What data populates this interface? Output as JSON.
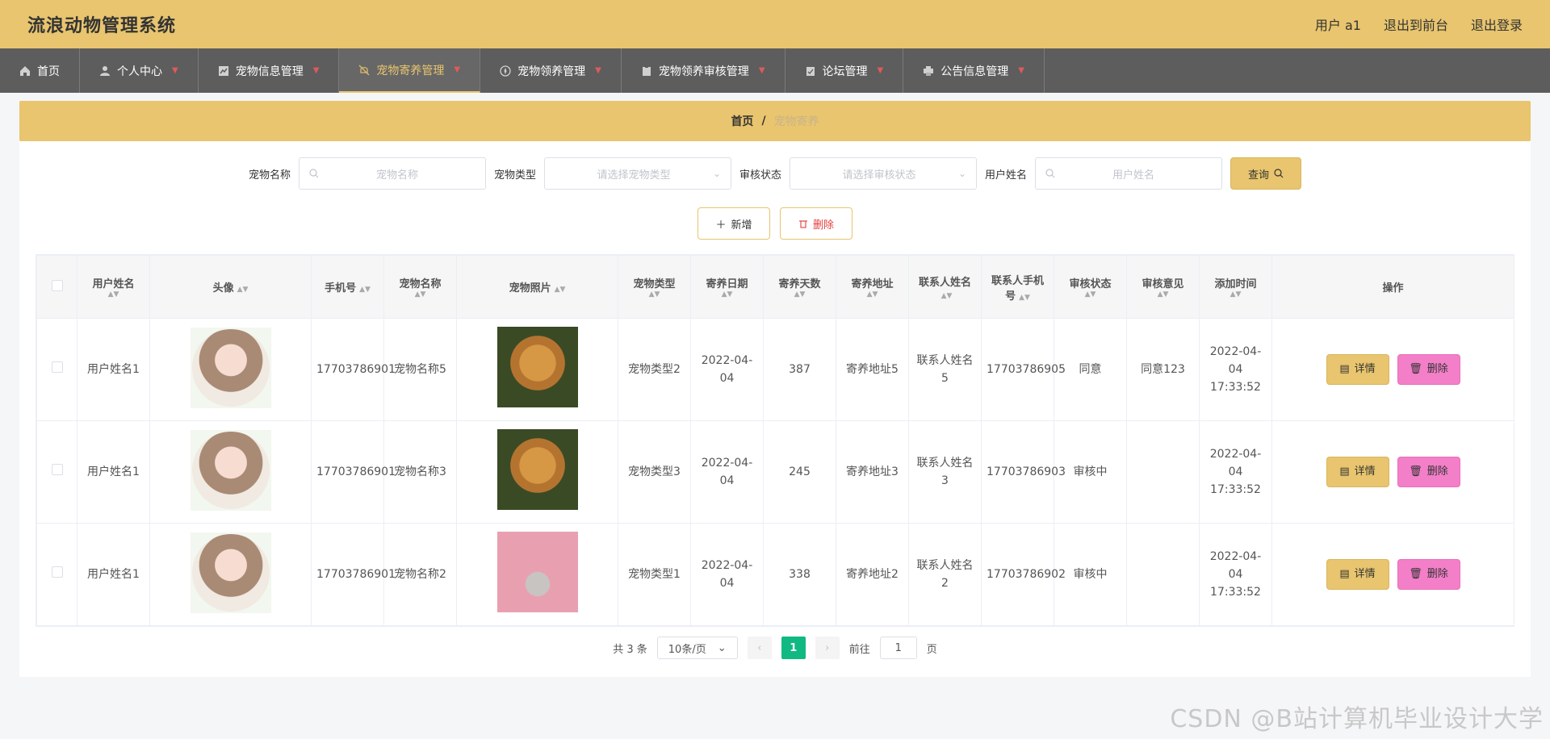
{
  "header": {
    "title": "流浪动物管理系统",
    "user": "用户 a1",
    "exit_front": "退出到前台",
    "logout": "退出登录"
  },
  "nav": {
    "items": [
      {
        "label": "首页",
        "icon": "home-icon"
      },
      {
        "label": "个人中心",
        "icon": "user-icon"
      },
      {
        "label": "宠物信息管理",
        "icon": "chart-icon"
      },
      {
        "label": "宠物寄养管理",
        "icon": "bell-off-icon"
      },
      {
        "label": "宠物领养管理",
        "icon": "compass-icon"
      },
      {
        "label": "宠物领养审核管理",
        "icon": "clipboard-icon"
      },
      {
        "label": "论坛管理",
        "icon": "clipboard-check-icon"
      },
      {
        "label": "公告信息管理",
        "icon": "printer-icon"
      }
    ],
    "active_index": 3,
    "accent": "#e8c56e"
  },
  "breadcrumb": {
    "home": "首页",
    "separator": "/",
    "current": "宠物寄养"
  },
  "search": {
    "pet_name_label": "宠物名称",
    "pet_name_placeholder": "宠物名称",
    "pet_type_label": "宠物类型",
    "pet_type_placeholder": "请选择宠物类型",
    "audit_label": "审核状态",
    "audit_placeholder": "请选择审核状态",
    "username_label": "用户姓名",
    "username_placeholder": "用户姓名",
    "query_label": "查询"
  },
  "actions": {
    "add_label": "新增",
    "delete_label": "删除"
  },
  "table": {
    "headers": {
      "username": "用户姓名",
      "avatar": "头像",
      "phone": "手机号",
      "pet_name": "宠物名称",
      "pet_photo": "宠物照片",
      "pet_type": "宠物类型",
      "foster_date": "寄养日期",
      "foster_days": "寄养天数",
      "foster_address": "寄养地址",
      "contact_name": "联系人姓名",
      "contact_phone": "联系人手机号",
      "audit_status": "审核状态",
      "audit_comment": "审核意见",
      "added_time": "添加时间",
      "operation": "操作"
    },
    "rows": [
      {
        "username": "用户姓名1",
        "phone": "17703786901",
        "pet_name": "宠物名称5",
        "pet_type": "宠物类型2",
        "foster_date": "2022-04-04",
        "foster_days": "387",
        "foster_address": "寄养地址5",
        "contact_name": "联系人姓名5",
        "contact_phone": "17703786905",
        "audit_status": "同意",
        "audit_comment": "同意123",
        "added_time": "2022-04-04 17:33:52"
      },
      {
        "username": "用户姓名1",
        "phone": "17703786901",
        "pet_name": "宠物名称3",
        "pet_type": "宠物类型3",
        "foster_date": "2022-04-04",
        "foster_days": "245",
        "foster_address": "寄养地址3",
        "contact_name": "联系人姓名3",
        "contact_phone": "17703786903",
        "audit_status": "审核中",
        "audit_comment": "",
        "added_time": "2022-04-04 17:33:52"
      },
      {
        "username": "用户姓名1",
        "phone": "17703786901",
        "pet_name": "宠物名称2",
        "pet_type": "宠物类型1",
        "foster_date": "2022-04-04",
        "foster_days": "338",
        "foster_address": "寄养地址2",
        "contact_name": "联系人姓名2",
        "contact_phone": "17703786902",
        "audit_status": "审核中",
        "audit_comment": "",
        "added_time": "2022-04-04 17:33:52"
      }
    ],
    "detail_label": "详情",
    "delete_label": "删除"
  },
  "pagination": {
    "total": "共 3 条",
    "page_size": "10条/页",
    "current_page": "1",
    "goto_label": "前往",
    "goto_value": "1",
    "page_unit": "页"
  },
  "watermark": "CSDN @B站计算机毕业设计大学"
}
